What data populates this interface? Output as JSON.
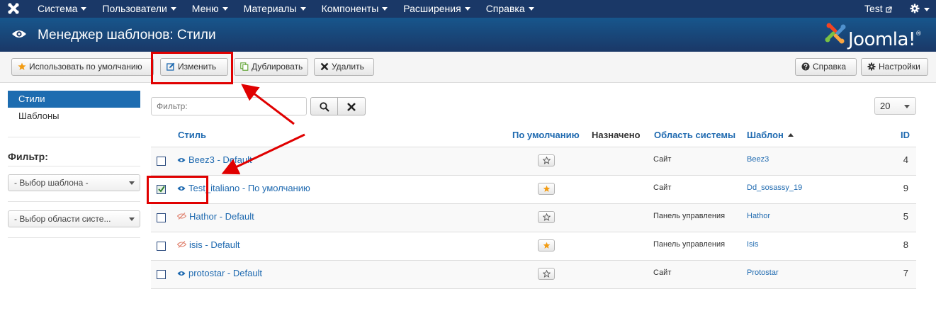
{
  "topnav": {
    "items": [
      "Система",
      "Пользователи",
      "Меню",
      "Материалы",
      "Компоненты",
      "Расширения",
      "Справка"
    ],
    "user": "Test"
  },
  "header": {
    "title": "Менеджер шаблонов: Стили",
    "logo_text": "Joomla!",
    "logo_mark": "®"
  },
  "toolbar": {
    "default_label": "Использовать по умолчанию",
    "edit_label": "Изменить",
    "duplicate_label": "Дублировать",
    "delete_label": "Удалить",
    "help_label": "Справка",
    "options_label": "Настройки"
  },
  "sidebar": {
    "items": [
      {
        "label": "Стили",
        "active": true
      },
      {
        "label": "Шаблоны",
        "active": false
      }
    ],
    "filter_title": "Фильтр:",
    "select_template": "- Выбор шаблона -",
    "select_location": "- Выбор области систе..."
  },
  "search": {
    "placeholder": "Фильтр:",
    "limit": "20"
  },
  "table": {
    "headers": {
      "style": "Стиль",
      "default": "По умолчанию",
      "assigned": "Назначено",
      "location": "Область системы",
      "template": "Шаблон",
      "id": "ID"
    },
    "rows": [
      {
        "name": "Beez3 - Default",
        "default": false,
        "location": "Сайт",
        "template": "Beez3",
        "id": "4",
        "checked": false,
        "visible": true
      },
      {
        "name": "Test_italiano - По умолчанию",
        "default": true,
        "location": "Сайт",
        "template": "Dd_sosassy_19",
        "id": "9",
        "checked": true,
        "visible": true
      },
      {
        "name": "Hathor - Default",
        "default": false,
        "location": "Панель управления",
        "template": "Hathor",
        "id": "5",
        "checked": false,
        "visible": false
      },
      {
        "name": "isis - Default",
        "default": true,
        "location": "Панель управления",
        "template": "Isis",
        "id": "8",
        "checked": false,
        "visible": false
      },
      {
        "name": "protostar - Default",
        "default": false,
        "location": "Сайт",
        "template": "Protostar",
        "id": "7",
        "checked": false,
        "visible": true
      }
    ]
  },
  "colors": {
    "nav": "#1a3867",
    "accent": "#1f6ab0",
    "highlight": "#e00000",
    "star": "#f39c12"
  }
}
